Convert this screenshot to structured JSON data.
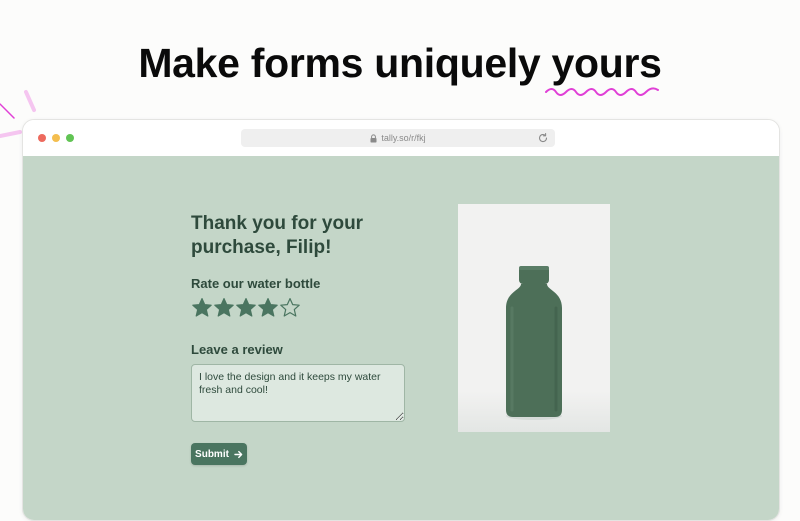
{
  "headline": {
    "text": "Make forms uniquely ",
    "accent_text": "yours",
    "squiggle_color": "#e040d6"
  },
  "browser": {
    "url": "tally.so/r/fkj",
    "traffic_lights": [
      "#ed6a5e",
      "#f4be4f",
      "#61c454"
    ],
    "icons": {
      "lock": "lock-icon",
      "reload": "reload-icon"
    }
  },
  "form": {
    "background_color": "#c4d6c8",
    "accent_color": "#4a7560",
    "title": "Thank you for your purchase, Filip!",
    "rating": {
      "label": "Rate our water bottle",
      "value": 4,
      "max": 5
    },
    "review": {
      "label": "Leave a review",
      "value": "I love the design and it keeps my water fresh and cool!"
    },
    "submit_label": "Submit",
    "submit_icon": "arrow-right-icon"
  },
  "product_image": {
    "subject": "water-bottle",
    "bottle_color": "#4d6f58"
  }
}
